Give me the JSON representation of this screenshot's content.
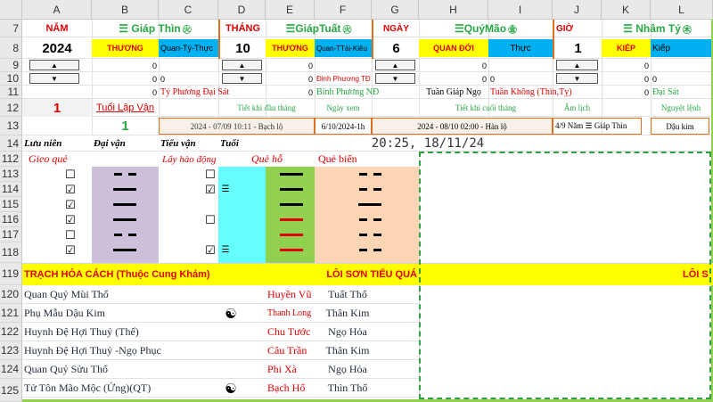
{
  "columns": [
    "",
    "A",
    "B",
    "C",
    "D",
    "E",
    "F",
    "G",
    "H",
    "I",
    "J",
    "K",
    "L"
  ],
  "rows": [
    "7",
    "8",
    "9",
    "10",
    "11",
    "12",
    "13",
    "14",
    "112",
    "113",
    "114",
    "115",
    "116",
    "117",
    "118",
    "119",
    "120",
    "121",
    "122",
    "123",
    "124",
    "125"
  ],
  "header_row7": {
    "nam": "NĂM",
    "giap_thin": "☰ Giáp Thìn",
    "giap_thin_icon": "㊋",
    "thang": "THÁNG",
    "giap_tuat": "☰GiápTuất",
    "giap_tuat_icon": "㊋",
    "ngay": "NGÀY",
    "quy_mao": "☰QuýMão",
    "quy_mao_icon": "㊎",
    "gio": "GIỜ",
    "nham_ty": "☰ Nhâm Tý",
    "nham_ty_icon": "㊍"
  },
  "row8": {
    "year": "2024",
    "b": "THƯƠNG",
    "c": "Quan-Tý-Thực",
    "month": "10",
    "e": "THƯƠNG",
    "f": "Quan-TTài-Kiêu",
    "day": "6",
    "h": "QUAN ĐỚI",
    "i": "Thực",
    "hour": "1",
    "k": "KIẾP",
    "l": "Kiếp"
  },
  "row9": {
    "b": "0",
    "e": "0",
    "h": "0",
    "k": "0"
  },
  "row10": {
    "b": "0",
    "c": "0",
    "e": "0",
    "f": "Đinh Phương TĐ",
    "h": "0",
    "i": "0",
    "k": "0",
    "l": "0"
  },
  "row11": {
    "b": "0",
    "c": "Tý Phương Đại Sát",
    "e": "0",
    "f": "Bính Phương NĐ",
    "g": "Tuần Giáp Ngọ",
    "h": "Tuần Không (Thìn,Tỵ)",
    "k": "0",
    "l": "Đại Sát"
  },
  "row12": {
    "a": "1",
    "b": "Tuổi Lập Vận",
    "d": "Tiết khí đầu tháng",
    "f": "Ngày xem",
    "h": "Tiết khí cuối tháng",
    "j": "Âm lịch",
    "l": "Nguyệt lệnh"
  },
  "row13": {
    "b": "1",
    "d": "2024 - 07/09 10:11 - Bạch lộ",
    "f": "6/10/2024-1h",
    "h": "2024 - 08/10 02:00 - Hàn lộ",
    "j": "4/9 Năm ☰ Giáp Thìn",
    "l": "Dậu kim"
  },
  "row14": {
    "a": "Lưu niên",
    "b": "Đại vận",
    "c": "Tiểu vận",
    "d": "Tuổi",
    "datetime": "20:25, 18/11/24"
  },
  "row112": {
    "gieo_que": "Gieo quẻ",
    "lay_hao": "Lấy hào động",
    "que_ho": "Quẻ hỗ",
    "que_bien": "Quẻ biến"
  },
  "row119": {
    "left": "TRẠCH HỎA CÁCH (Thuộc Cung Khảm)",
    "right": "LÔI SƠN TIỂU QUÁ",
    "far": "LÔI S"
  },
  "lines": [
    {
      "row": "120",
      "name": "Quan Quỷ Mùi Thổ",
      "than": "Huyền Vũ",
      "hao": "Tuất Thổ",
      "yy": ""
    },
    {
      "row": "121",
      "name": "Phụ Mẫu Dậu Kim",
      "than": "Thanh Long",
      "hao": "Thân Kim",
      "yy": "☯"
    },
    {
      "row": "122",
      "name": "Huynh Đệ Hợi Thuỷ (Thế)",
      "than": "Chu Tước",
      "hao": "Ngọ Hỏa",
      "yy": ""
    },
    {
      "row": "123",
      "name": "Huynh Đệ Hợi Thuỷ -Ngọ Phục",
      "than": "Câu Trần",
      "hao": "Thân Kim",
      "yy": ""
    },
    {
      "row": "124",
      "name": "Quan Quỷ Sửu Thổ",
      "than": "Phi Xà",
      "hao": "Ngọ Hỏa",
      "yy": ""
    },
    {
      "row": "125",
      "name": "Tử Tôn Mão Mộc (Ứng)(QT)",
      "than": "Bạch Hổ",
      "hao": "Thìn Thổ",
      "yy": "☯"
    }
  ],
  "hexagram_rows": [
    {
      "cb1": "☐",
      "cb2": "☐",
      "tri": "",
      "b": "yin",
      "e": "yang",
      "f": "yin",
      "h": "yin"
    },
    {
      "cb1": "☑",
      "cb2": "☑",
      "tri": "☰",
      "b": "yang",
      "e": "yang",
      "f": "yin",
      "h": "yin"
    },
    {
      "cb1": "☑",
      "cb2": "",
      "tri": "",
      "b": "yang",
      "e": "yang",
      "f": "yang",
      "h": "yang"
    },
    {
      "cb1": "",
      "cb2": "",
      "tri": "",
      "b": "",
      "e": "",
      "f": "",
      "h": ""
    },
    {
      "cb1": "☑",
      "cb2": "☐",
      "tri": "",
      "b": "yang",
      "e": "yang",
      "f": "yang",
      "h": "yin"
    },
    {
      "cb1": "☐",
      "cb2": "",
      "tri": "",
      "b": "yin",
      "e": "yang",
      "f": "yin",
      "h": "yin"
    },
    {
      "cb1": "☑",
      "cb2": "☑",
      "tri": "☰",
      "b": "yang",
      "e": "yang",
      "f": "yin",
      "h": "yin"
    }
  ],
  "colors": {
    "yellow": "#ffff00",
    "green": "#92d050",
    "teal": "#00b0f0",
    "cyan": "#66ffff",
    "lavender": "#ccc0da",
    "peach": "#fcd5b4",
    "red": "#e00000",
    "orange": "#e07020"
  }
}
